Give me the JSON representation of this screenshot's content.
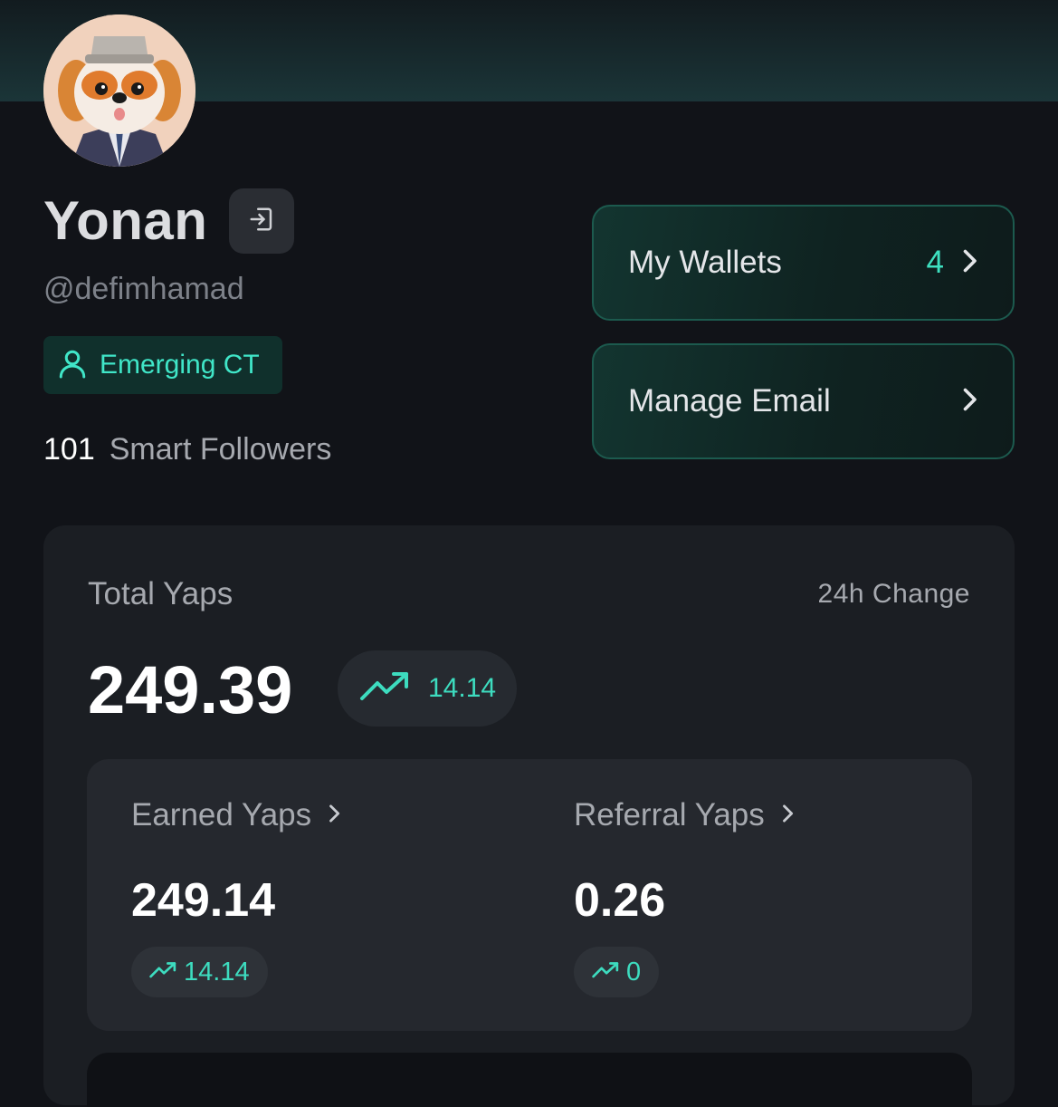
{
  "profile": {
    "name": "Yonan",
    "handle": "@defimhamad",
    "tier": "Emerging CT",
    "smart_followers_count": "101",
    "smart_followers_label": "Smart Followers"
  },
  "actions": {
    "wallets": {
      "label": "My Wallets",
      "count": "4"
    },
    "email": {
      "label": "Manage Email"
    }
  },
  "stats": {
    "total_label": "Total Yaps",
    "change_label": "24h Change",
    "total_value": "249.39",
    "total_change": "14.14",
    "earned": {
      "label": "Earned Yaps",
      "value": "249.14",
      "change": "14.14"
    },
    "referral": {
      "label": "Referral Yaps",
      "value": "0.26",
      "change": "0"
    }
  },
  "icons": {
    "logout": "logout-icon",
    "tier": "user-icon",
    "chevron": "chevron-right-icon",
    "trend": "trending-up-icon"
  },
  "colors": {
    "accent": "#3ddcbf",
    "background": "#111318",
    "panel": "#1b1e23"
  }
}
